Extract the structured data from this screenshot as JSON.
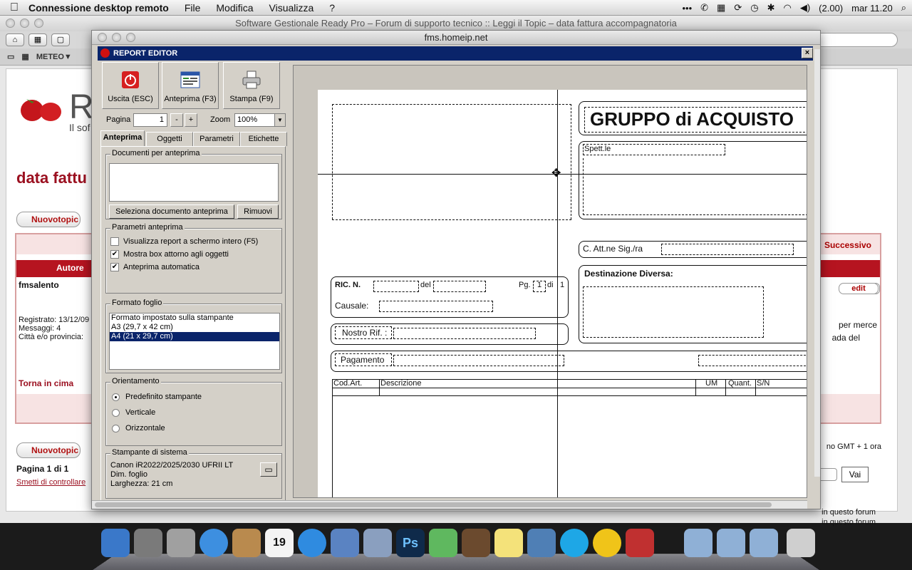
{
  "menubar": {
    "app_name": "Connessione desktop remoto",
    "items": [
      "File",
      "Modifica",
      "Visualizza",
      "?"
    ],
    "battery": "(2.00)",
    "clock": "mar 11.20"
  },
  "browser": {
    "title": "Software Gestionale Ready Pro – Forum di supporto tecnico :: Leggi il Topic – data fattura accompagnatoria",
    "bookmark_meteo": "METEO▼",
    "logo_letter": "R",
    "logo_sub": "Il sof",
    "page_title": "data fattu",
    "nuovo_topic": "Nuovotopic",
    "autore_header": "Autore",
    "successivo": "Successivo",
    "author_name": "fmsalento",
    "registrato": "Registrato: 13/12/09",
    "messaggi": "Messaggi: 4",
    "citta": "Città e/o provincia:",
    "torna_in_cima": "Torna in cima",
    "edit_label": "edit",
    "post_snippet_1": "per merce",
    "post_snippet_2": "ada del",
    "pagina": "Pagina 1 di 1",
    "smetti": "Smetti di controllare",
    "timezone": "no GMT + 1 ora",
    "vai": "Vai",
    "forum_line_1": "in questo forum",
    "forum_line_2": "in questo forum"
  },
  "rdc": {
    "title": "fms.homeip.net"
  },
  "editor": {
    "title": "REPORT EDITOR",
    "close": "×",
    "buttons": {
      "exit": "Uscita (ESC)",
      "preview": "Anteprima (F3)",
      "print": "Stampa (F9)"
    },
    "pagina_label": "Pagina",
    "pagina_value": "1",
    "minus": "-",
    "plus": "+",
    "zoom_label": "Zoom",
    "zoom_value": "100%",
    "tabs": [
      "Anteprima",
      "Oggetti",
      "Parametri",
      "Etichette"
    ],
    "docs_group": "Documenti per anteprima",
    "select_doc_btn": "Seleziona documento anteprima",
    "remove_btn": "Rimuovi",
    "params_group": "Parametri anteprima",
    "checks": [
      {
        "label": "Visualizza report a schermo intero (F5)",
        "checked": false
      },
      {
        "label": "Mostra box attorno agli oggetti",
        "checked": true
      },
      {
        "label": "Anteprima automatica",
        "checked": true
      }
    ],
    "format_group": "Formato foglio",
    "formats": [
      "Formato impostato sulla stampante",
      "A3 (29,7 x 42 cm)",
      "A4 (21 x 29,7 cm)"
    ],
    "format_selected": 2,
    "orient_group": "Orientamento",
    "orientations": [
      "Predefinito stampante",
      "Verticale",
      "Orizzontale"
    ],
    "orient_selected": 0,
    "printer_group": "Stampante di sistema",
    "printer_lines": [
      "Canon iR2022/2025/2030 UFRII LT",
      "Dim. foglio",
      "Larghezza: 21 cm"
    ]
  },
  "report": {
    "gruppo": "GRUPPO di ACQUISTO",
    "spett": "Spett.le",
    "att": "C. Att.ne Sig./ra",
    "dest": "Destinazione Diversa:",
    "ric": "RIC. N.",
    "del": "del",
    "pg": "Pg.",
    "pg_num": "1",
    "di": "di",
    "pg_tot": "1",
    "causale": "Causale:",
    "nostro_rif": "Nostro Rif. :",
    "pagamento": "Pagamento",
    "columns": [
      "Cod.Art.",
      "Descrizione",
      "UM",
      "Quant.",
      "S/N"
    ]
  },
  "dock": {
    "calendar_day": "19",
    "ps_label": "Ps"
  }
}
